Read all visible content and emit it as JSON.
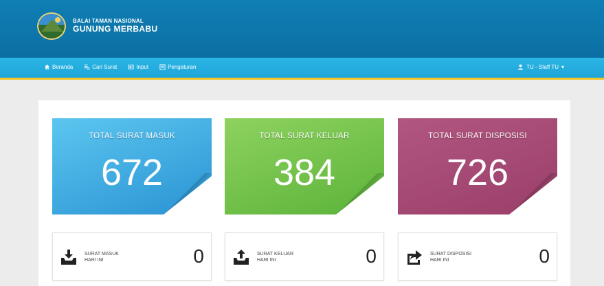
{
  "header": {
    "org_line1": "BALAI TAMAN NASIONAL",
    "org_line2": "GUNUNG MERBABU",
    "logo_icon": "park-logo-icon"
  },
  "nav": {
    "items": [
      {
        "label": "Beranda",
        "icon": "home-icon"
      },
      {
        "label": "Cari Surat",
        "icon": "search-list-icon"
      },
      {
        "label": "Input",
        "icon": "input-icon"
      },
      {
        "label": "Pengaturan",
        "icon": "settings-icon"
      }
    ],
    "user_label": "TU - Staff TU"
  },
  "stats": [
    {
      "label": "TOTAL SURAT MASUK",
      "value": "672",
      "color": "#3aa6df"
    },
    {
      "label": "TOTAL SURAT KELUAR",
      "value": "384",
      "color": "#6cc046"
    },
    {
      "label": "TOTAL SURAT DISPOSISI",
      "value": "726",
      "color": "#a54a74"
    }
  ],
  "today": [
    {
      "line1": "SURAT MASUK",
      "line2": "HARI INI",
      "value": "0",
      "icon": "inbox-download-icon"
    },
    {
      "line1": "SURAT KELUAR",
      "line2": "HARI INI",
      "value": "0",
      "icon": "outbox-upload-icon"
    },
    {
      "line1": "SURAT DISPOSISI",
      "line2": "HARI INI",
      "value": "0",
      "icon": "share-icon"
    }
  ]
}
